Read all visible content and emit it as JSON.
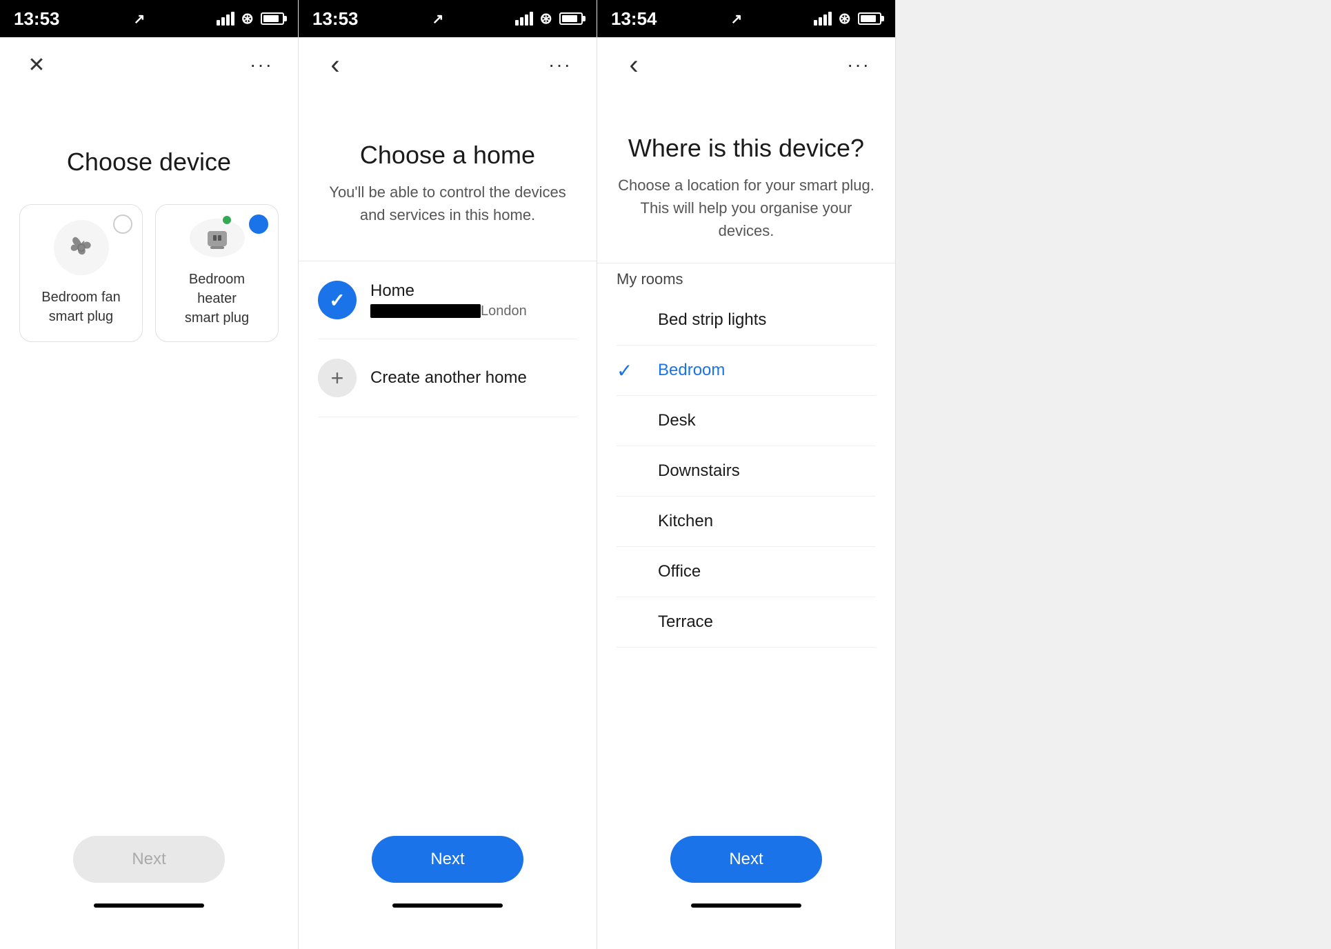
{
  "screens": [
    {
      "id": "screen1",
      "status_time": "13:53",
      "has_location": true,
      "nav_left": "close",
      "nav_right": "more",
      "title": "Choose device",
      "devices": [
        {
          "name_line1": "Bedroom fan",
          "name_line2": "smart plug",
          "selected": false,
          "has_green_dot": false,
          "icon_type": "fan"
        },
        {
          "name_line1": "Bedroom heater",
          "name_line2": "smart plug",
          "selected": true,
          "has_green_dot": true,
          "icon_type": "plug"
        }
      ],
      "next_label": "Next",
      "next_enabled": false
    },
    {
      "id": "screen2",
      "status_time": "13:53",
      "has_location": true,
      "nav_left": "back",
      "nav_right": "more",
      "title": "Choose a home",
      "subtitle": "You'll be able to control the devices and services in this home.",
      "homes": [
        {
          "name": "Home",
          "address_visible": false,
          "address_redacted": true,
          "city": "London",
          "selected": true
        },
        {
          "name": "Create another home",
          "selected": false,
          "is_add": true
        }
      ],
      "next_label": "Next",
      "next_enabled": true
    },
    {
      "id": "screen3",
      "status_time": "13:54",
      "has_location": true,
      "nav_left": "back",
      "nav_right": "more",
      "title": "Where is this device?",
      "subtitle": "Choose a location for your smart plug. This will help you organise your devices.",
      "rooms_label": "My rooms",
      "rooms": [
        {
          "name": "Bed strip lights",
          "selected": false
        },
        {
          "name": "Bedroom",
          "selected": true
        },
        {
          "name": "Desk",
          "selected": false
        },
        {
          "name": "Downstairs",
          "selected": false
        },
        {
          "name": "Kitchen",
          "selected": false
        },
        {
          "name": "Office",
          "selected": false
        },
        {
          "name": "Terrace",
          "selected": false
        }
      ],
      "next_label": "Next",
      "next_enabled": true
    }
  ],
  "icons": {
    "close": "✕",
    "back": "‹",
    "more": "···",
    "check": "✓",
    "plus": "+"
  }
}
